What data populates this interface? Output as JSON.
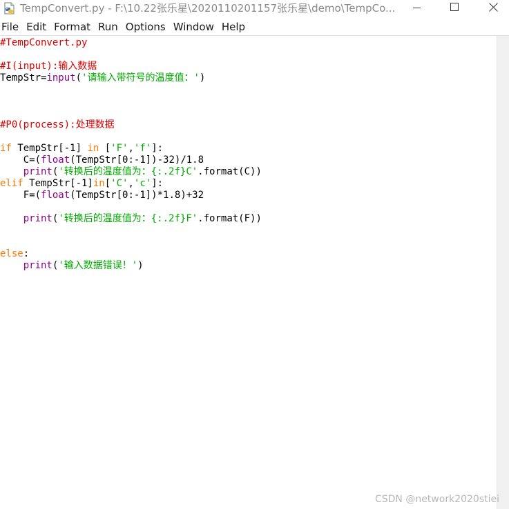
{
  "window": {
    "title": "TempConvert.py - F:\\10.22张乐星\\2020110201157张乐星\\demo\\TempCo...",
    "minimize_icon": "minimize-icon",
    "maximize_icon": "maximize-icon",
    "close_icon": "close-icon"
  },
  "menubar": {
    "items": [
      "File",
      "Edit",
      "Format",
      "Run",
      "Options",
      "Window",
      "Help"
    ]
  },
  "editor": {
    "lines": [
      [
        {
          "t": "comment",
          "s": "#TempConvert.py"
        }
      ],
      [],
      [
        {
          "t": "comment",
          "s": "#I(input):输入数据"
        }
      ],
      [
        {
          "t": "plain",
          "s": "TempStr="
        },
        {
          "t": "builtin",
          "s": "input"
        },
        {
          "t": "plain",
          "s": "("
        },
        {
          "t": "string",
          "s": "'请输入带符号的温度值：'"
        },
        {
          "t": "plain",
          "s": ")"
        }
      ],
      [],
      [],
      [],
      [
        {
          "t": "comment",
          "s": "#P0(process):处理数据"
        }
      ],
      [],
      [
        {
          "t": "keyword",
          "s": "if"
        },
        {
          "t": "plain",
          "s": " TempStr[-1] "
        },
        {
          "t": "keyword",
          "s": "in"
        },
        {
          "t": "plain",
          "s": " ["
        },
        {
          "t": "string",
          "s": "'F'"
        },
        {
          "t": "plain",
          "s": ","
        },
        {
          "t": "string",
          "s": "'f'"
        },
        {
          "t": "plain",
          "s": "]:"
        }
      ],
      [
        {
          "t": "plain",
          "s": "    C=("
        },
        {
          "t": "builtin",
          "s": "float"
        },
        {
          "t": "plain",
          "s": "(TempStr[0:-1])-32)/1.8"
        }
      ],
      [
        {
          "t": "plain",
          "s": "    "
        },
        {
          "t": "builtin",
          "s": "print"
        },
        {
          "t": "plain",
          "s": "("
        },
        {
          "t": "string",
          "s": "'转换后的温度值为：{:.2f}C'"
        },
        {
          "t": "plain",
          "s": ".format(C))"
        }
      ],
      [
        {
          "t": "keyword",
          "s": "elif"
        },
        {
          "t": "plain",
          "s": " TempStr[-1]"
        },
        {
          "t": "keyword",
          "s": "in"
        },
        {
          "t": "plain",
          "s": "["
        },
        {
          "t": "string",
          "s": "'C'"
        },
        {
          "t": "plain",
          "s": ","
        },
        {
          "t": "string",
          "s": "'c'"
        },
        {
          "t": "plain",
          "s": "]:"
        }
      ],
      [
        {
          "t": "plain",
          "s": "    F=("
        },
        {
          "t": "builtin",
          "s": "float"
        },
        {
          "t": "plain",
          "s": "(TempStr[0:-1])*1.8)+32"
        }
      ],
      [],
      [
        {
          "t": "plain",
          "s": "    "
        },
        {
          "t": "builtin",
          "s": "print"
        },
        {
          "t": "plain",
          "s": "("
        },
        {
          "t": "string",
          "s": "'转换后的温度值为：{:.2f}F'"
        },
        {
          "t": "plain",
          "s": ".format(F))"
        }
      ],
      [],
      [],
      [
        {
          "t": "keyword",
          "s": "else"
        },
        {
          "t": "plain",
          "s": ":"
        }
      ],
      [
        {
          "t": "plain",
          "s": "    "
        },
        {
          "t": "builtin",
          "s": "print"
        },
        {
          "t": "plain",
          "s": "("
        },
        {
          "t": "string",
          "s": "'输入数据错误！'"
        },
        {
          "t": "plain",
          "s": ")"
        }
      ]
    ]
  },
  "colors": {
    "comment": "#dd0000",
    "keyword": "#ff7700",
    "builtin": "#900090",
    "string": "#00aa00"
  },
  "watermark": "CSDN @network2020stiei"
}
